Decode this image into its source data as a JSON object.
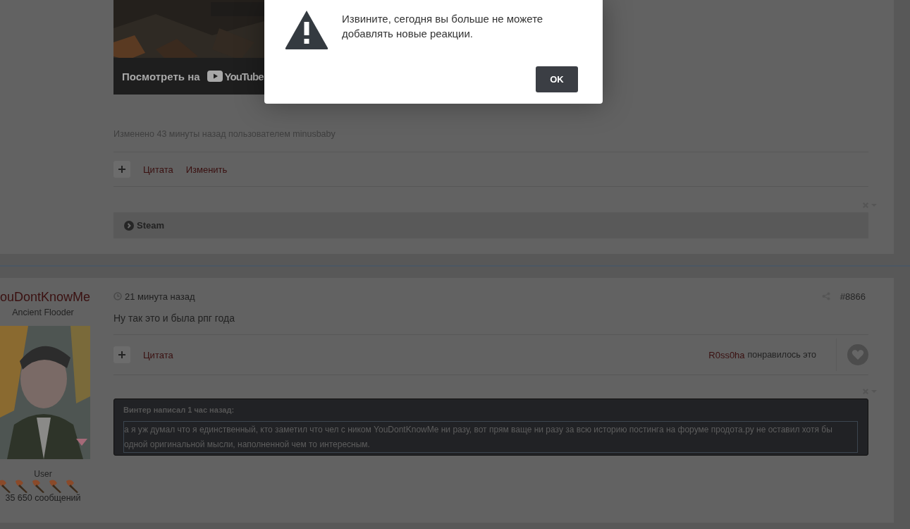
{
  "previous_post": {
    "video": {
      "kind": "picture",
      "watch_label": "Посмотреть на",
      "logo_text": "YouTube"
    },
    "edited_note": "Изменено 43 минуты назад пользователем minusbaby",
    "actions": [
      {
        "label": "Цитата"
      },
      {
        "label": "Изменить"
      }
    ],
    "spoiler": {
      "title": "Steam",
      "expanded": false
    }
  },
  "post": {
    "author": {
      "name": "ouDontKnowMe",
      "title": "Ancient Flooder",
      "group": "User",
      "posts_count": "35 650 сообщений"
    },
    "time": "21 минута назад",
    "number": "#8866",
    "body": "Ну так это и была рпг года",
    "actions": [
      {
        "label": "Цитата"
      }
    ],
    "like": {
      "user": "R0ss0ha",
      "text": "понравилось это"
    },
    "quote": {
      "header": "Винтер написал 1 час назад:",
      "text": "а я уж думал что я единственный, кто заметил что чел с ником YouDontKnowMe ни разу, вот прям ваще ни разу за всю историю постинга на форуме продота.ру не оставил хотя бы одной оригинальной мысли, наполненной чем то интересным."
    }
  },
  "dialog": {
    "message": "Извините, сегодня вы больше не можете добавлять новые реакции.",
    "button": "OK"
  }
}
